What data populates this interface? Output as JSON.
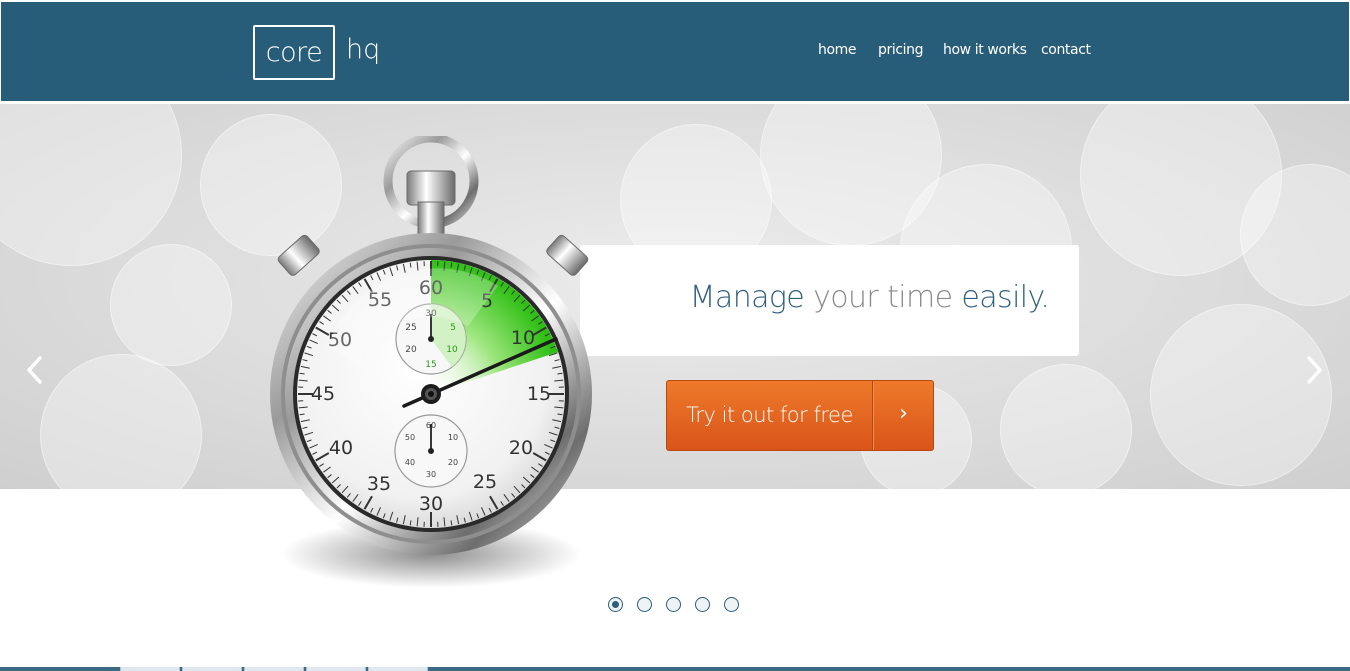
{
  "brand": {
    "logo_boxed": "core",
    "logo_suffix": "hq"
  },
  "nav": {
    "items": [
      "home",
      "pricing",
      "how it works",
      "contact"
    ]
  },
  "hero": {
    "tagline_part1": "Manage",
    "tagline_part2": "your time",
    "tagline_part3": "easily.",
    "cta_label": "Try it out for free",
    "cta_arrow": "›"
  },
  "stopwatch": {
    "main_numbers": [
      "60",
      "5",
      "10",
      "15",
      "20",
      "25",
      "30",
      "35",
      "40",
      "45",
      "50",
      "55"
    ],
    "top_subdial_numbers": [
      "30",
      "5",
      "10",
      "15",
      "20",
      "25"
    ],
    "bottom_subdial_numbers": [
      "60",
      "10",
      "20",
      "30",
      "40",
      "50"
    ]
  },
  "slider": {
    "slide_count": 5,
    "active_index": 0
  },
  "colors": {
    "header": "#285d79",
    "accent": "#e0601f",
    "green": "#36c51b"
  },
  "icons": [
    "chevron-left-icon",
    "chevron-right-icon",
    "chevron-right-icon"
  ]
}
